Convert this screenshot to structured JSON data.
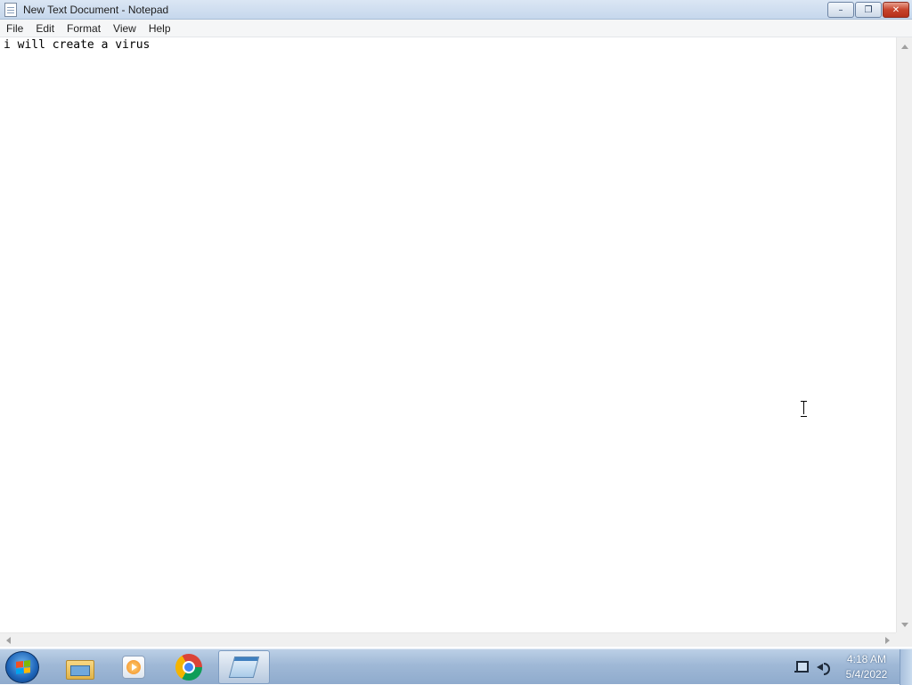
{
  "window": {
    "title": "New Text Document - Notepad",
    "controls": {
      "minimize_glyph": "–",
      "restore_glyph": "❐",
      "close_glyph": "✕"
    }
  },
  "menubar": {
    "items": [
      {
        "label": "File"
      },
      {
        "label": "Edit"
      },
      {
        "label": "Format"
      },
      {
        "label": "View"
      },
      {
        "label": "Help"
      }
    ]
  },
  "editor": {
    "content": "i will create a virus"
  },
  "taskbar": {
    "pinned": [
      {
        "name": "windows-explorer",
        "icon": "folder-icon"
      },
      {
        "name": "windows-media-player",
        "icon": "media-player-icon"
      },
      {
        "name": "google-chrome",
        "icon": "chrome-icon"
      },
      {
        "name": "notepad",
        "icon": "notepad-icon",
        "active": true
      }
    ],
    "clock": {
      "time": "4:18 AM",
      "date": "5/4/2022"
    }
  },
  "colors": {
    "titlebar": "#c6d7ec",
    "menubar": "#f5f6f7",
    "taskbar": "#9fb8d6",
    "close_button": "#c7432b"
  }
}
